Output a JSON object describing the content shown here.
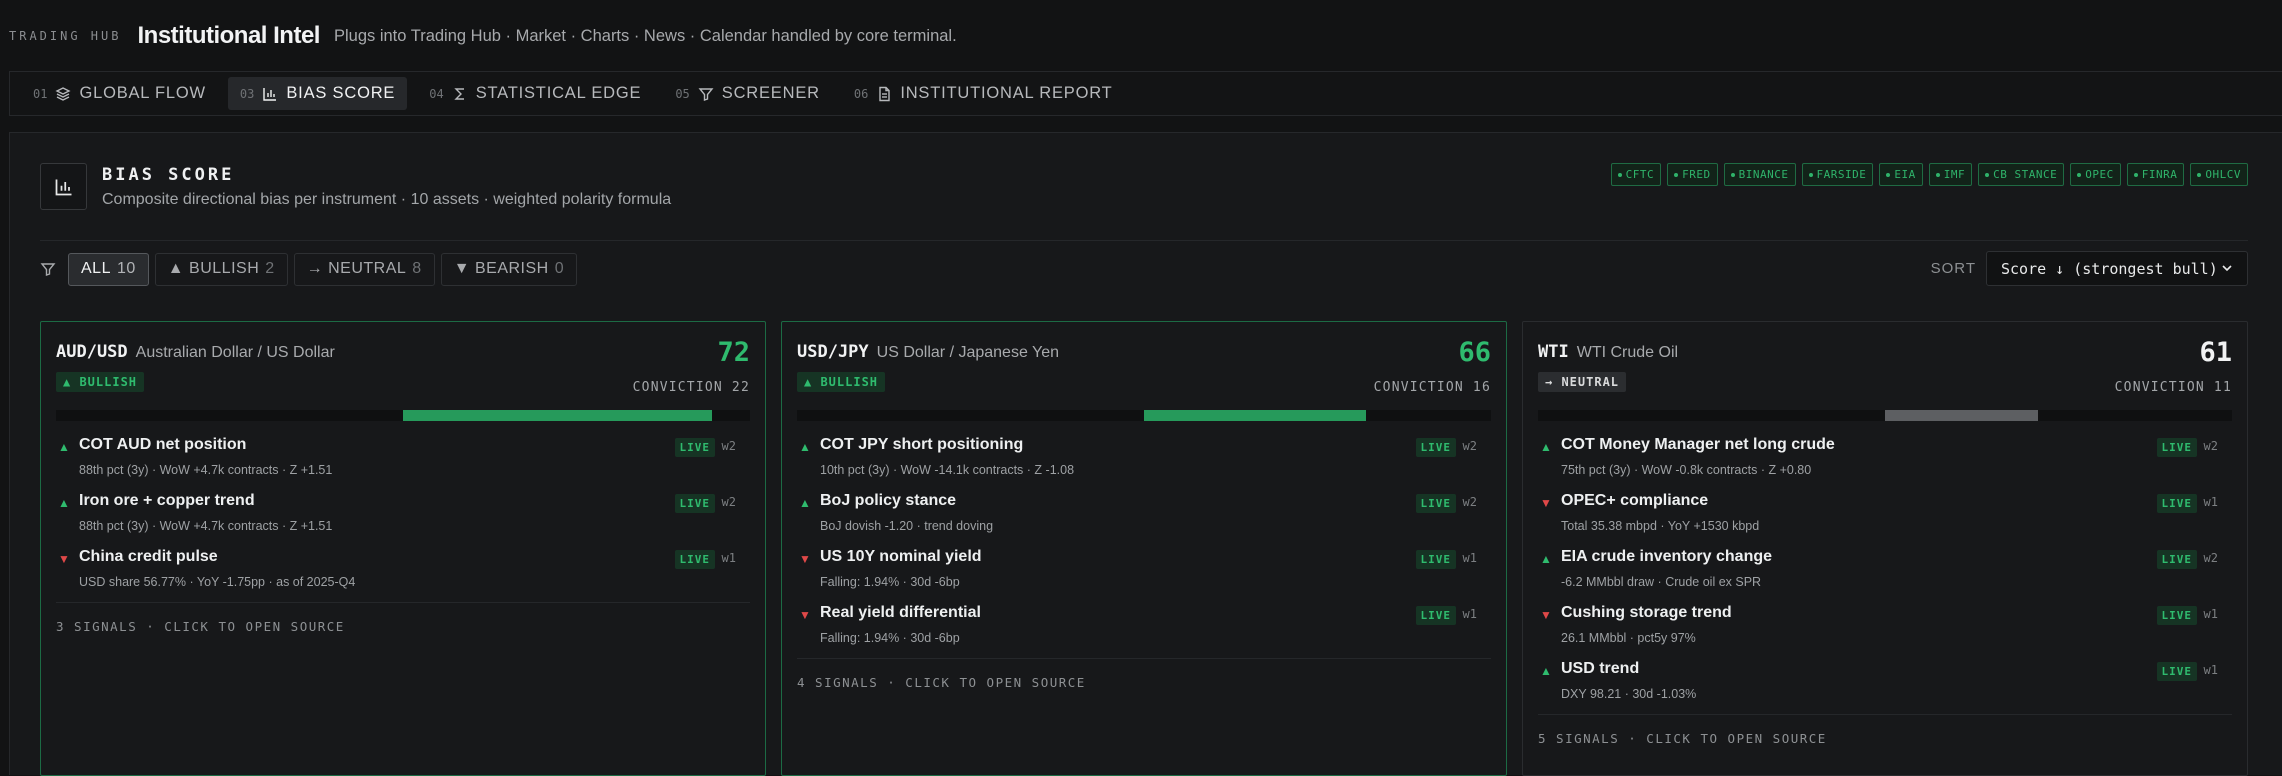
{
  "header": {
    "brand": "TRADING HUB",
    "title": "Institutional Intel",
    "subtitle": "Plugs into Trading Hub · Market · Charts · News · Calendar handled by core terminal."
  },
  "tabs": [
    {
      "num": "01",
      "label": "GLOBAL FLOW",
      "icon": "layers-icon"
    },
    {
      "num": "03",
      "label": "BIAS SCORE",
      "icon": "bar-chart-icon",
      "active": true
    },
    {
      "num": "04",
      "label": "STATISTICAL EDGE",
      "icon": "sigma-icon"
    },
    {
      "num": "05",
      "label": "SCREENER",
      "icon": "filter-icon"
    },
    {
      "num": "06",
      "label": "INSTITUTIONAL REPORT",
      "icon": "document-icon"
    }
  ],
  "panel": {
    "title": "BIAS SCORE",
    "subtitle": "Composite directional bias per instrument · 10 assets · weighted polarity formula",
    "sources": [
      "CFTC",
      "FRED",
      "BINANCE",
      "FARSIDE",
      "EIA",
      "IMF",
      "CB STANCE",
      "OPEC",
      "FINRA",
      "OHLCV"
    ]
  },
  "filters": {
    "chips": [
      {
        "label": "ALL",
        "count": "10",
        "active": true
      },
      {
        "label": "▲ BULLISH",
        "count": "2"
      },
      {
        "label": "→ NEUTRAL",
        "count": "8"
      },
      {
        "label": "▼ BEARISH",
        "count": "0"
      }
    ],
    "sort_label": "SORT",
    "sort_value": "Score ↓ (strongest bull)"
  },
  "colors": {
    "bull": "#2fbb6e",
    "bear": "#e04848",
    "neutral": "#5d5f62"
  },
  "cards": [
    {
      "symbol": "AUD/USD",
      "name": "Australian Dollar / US Dollar",
      "badge": "▲ BULLISH",
      "tone": "bull",
      "score": "72",
      "conviction": "CONVICTION 22",
      "bar_start": 0.5,
      "bar_end": 0.945,
      "signals": [
        {
          "dir": "up",
          "title": "COT AUD net position",
          "meta": "88th pct (3y) · WoW +4.7k contracts · Z +1.51",
          "live": "LIVE",
          "w": "w2"
        },
        {
          "dir": "up",
          "title": "Iron ore + copper trend",
          "meta": "88th pct (3y) · WoW +4.7k contracts · Z +1.51",
          "live": "LIVE",
          "w": "w2"
        },
        {
          "dir": "down",
          "title": "China credit pulse",
          "meta": "USD share 56.77% · YoY -1.75pp · as of 2025-Q4",
          "live": "LIVE",
          "w": "w1"
        }
      ],
      "footer": "3 SIGNALS · CLICK TO OPEN SOURCE"
    },
    {
      "symbol": "USD/JPY",
      "name": "US Dollar / Japanese Yen",
      "badge": "▲ BULLISH",
      "tone": "bull",
      "score": "66",
      "conviction": "CONVICTION 16",
      "bar_start": 0.5,
      "bar_end": 0.82,
      "signals": [
        {
          "dir": "up",
          "title": "COT JPY short positioning",
          "meta": "10th pct (3y) · WoW -14.1k contracts · Z -1.08",
          "live": "LIVE",
          "w": "w2"
        },
        {
          "dir": "up",
          "title": "BoJ policy stance",
          "meta": "BoJ dovish -1.20 · trend doving",
          "live": "LIVE",
          "w": "w2"
        },
        {
          "dir": "down",
          "title": "US 10Y nominal yield",
          "meta": "Falling: 1.94% · 30d -6bp",
          "live": "LIVE",
          "w": "w1"
        },
        {
          "dir": "down",
          "title": "Real yield differential",
          "meta": "Falling: 1.94% · 30d -6bp",
          "live": "LIVE",
          "w": "w1"
        }
      ],
      "footer": "4 SIGNALS · CLICK TO OPEN SOURCE"
    },
    {
      "symbol": "WTI",
      "name": "WTI Crude Oil",
      "badge": "→ NEUTRAL",
      "tone": "neutral",
      "score": "61",
      "conviction": "CONVICTION 11",
      "bar_start": 0.5,
      "bar_end": 0.72,
      "signals": [
        {
          "dir": "up",
          "title": "COT Money Manager net long crude",
          "meta": "75th pct (3y) · WoW -0.8k contracts · Z +0.80",
          "live": "LIVE",
          "w": "w2"
        },
        {
          "dir": "down",
          "title": "OPEC+ compliance",
          "meta": "Total 35.38 mbpd · YoY +1530 kbpd",
          "live": "LIVE",
          "w": "w1"
        },
        {
          "dir": "up",
          "title": "EIA crude inventory change",
          "meta": "-6.2 MMbbl draw · Crude oil ex SPR",
          "live": "LIVE",
          "w": "w2"
        },
        {
          "dir": "down",
          "title": "Cushing storage trend",
          "meta": "26.1 MMbbl · pct5y 97%",
          "live": "LIVE",
          "w": "w1"
        },
        {
          "dir": "up",
          "title": "USD trend",
          "meta": "DXY 98.21 · 30d -1.03%",
          "live": "LIVE",
          "w": "w1"
        }
      ],
      "footer": "5 SIGNALS · CLICK TO OPEN SOURCE"
    }
  ]
}
